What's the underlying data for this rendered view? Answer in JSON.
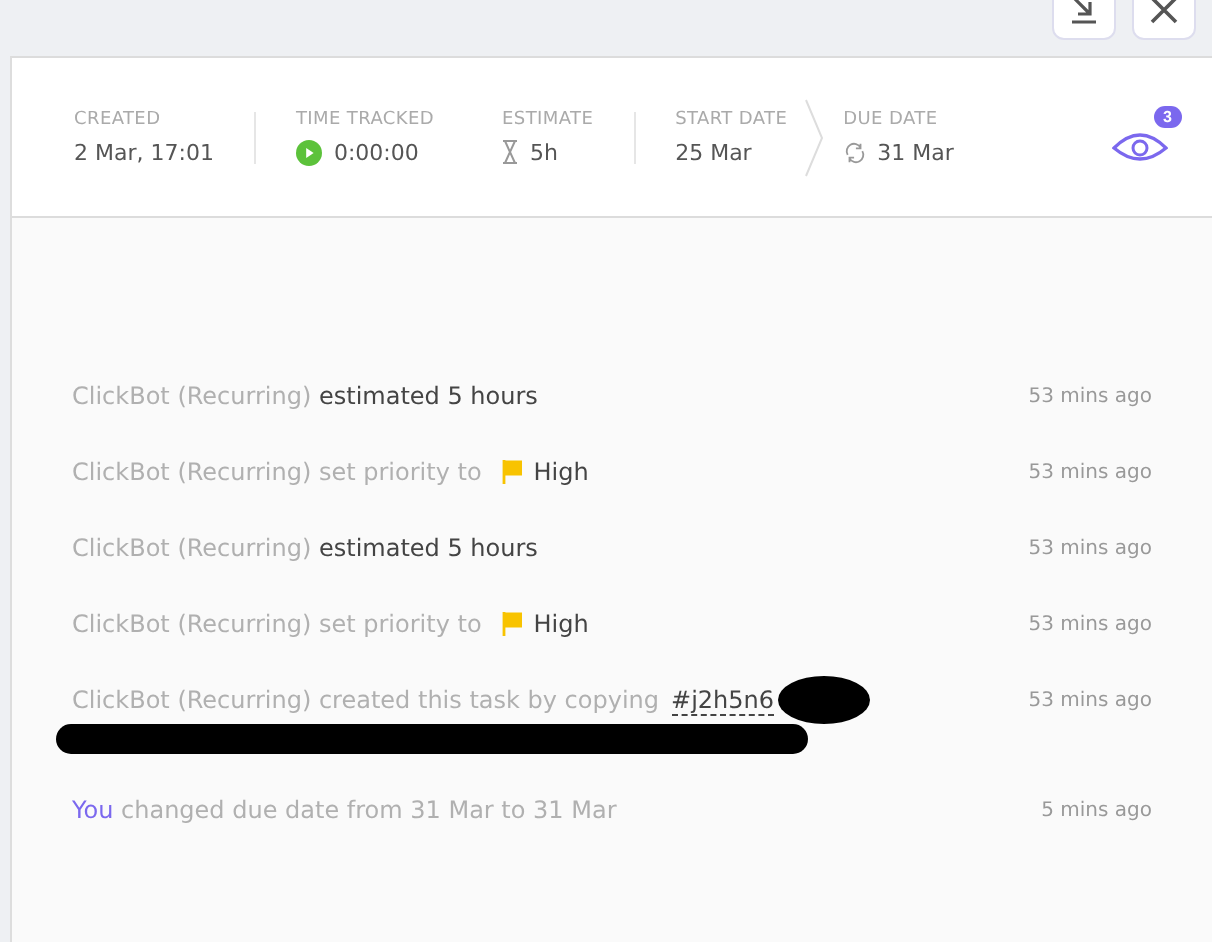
{
  "header": {
    "fields": [
      {
        "kind": "created",
        "label": "CREATED",
        "value": "2 Mar, 17:01"
      },
      {
        "kind": "timer",
        "label": "TIME TRACKED",
        "value": "0:00:00"
      },
      {
        "kind": "estimate",
        "label": "ESTIMATE",
        "value": "5h"
      },
      {
        "kind": "start",
        "label": "START DATE",
        "value": "25 Mar"
      },
      {
        "kind": "due",
        "label": "DUE DATE",
        "value": "31 Mar"
      }
    ],
    "watchers_count": "3"
  },
  "activity": [
    {
      "kind": "estimate",
      "actor": "ClickBot (Recurring)",
      "action": "estimated 5 hours",
      "time": "53 mins ago"
    },
    {
      "kind": "priority",
      "actor": "ClickBot (Recurring)",
      "action": "set priority to",
      "value": "High",
      "color": "#f8c300",
      "time": "53 mins ago"
    },
    {
      "kind": "estimate",
      "actor": "ClickBot (Recurring)",
      "action": "estimated 5 hours",
      "time": "53 mins ago"
    },
    {
      "kind": "priority",
      "actor": "ClickBot (Recurring)",
      "action": "set priority to",
      "value": "High",
      "color": "#f8c300",
      "time": "53 mins ago"
    },
    {
      "kind": "copy",
      "actor": "ClickBot (Recurring)",
      "action": "created this task by copying",
      "link": "#j2h5n6",
      "redacted": true,
      "time": "53 mins ago"
    },
    {
      "kind": "change",
      "actor": "You",
      "action": "changed due date from 31 Mar to 31 Mar",
      "time": "5 mins ago"
    }
  ]
}
